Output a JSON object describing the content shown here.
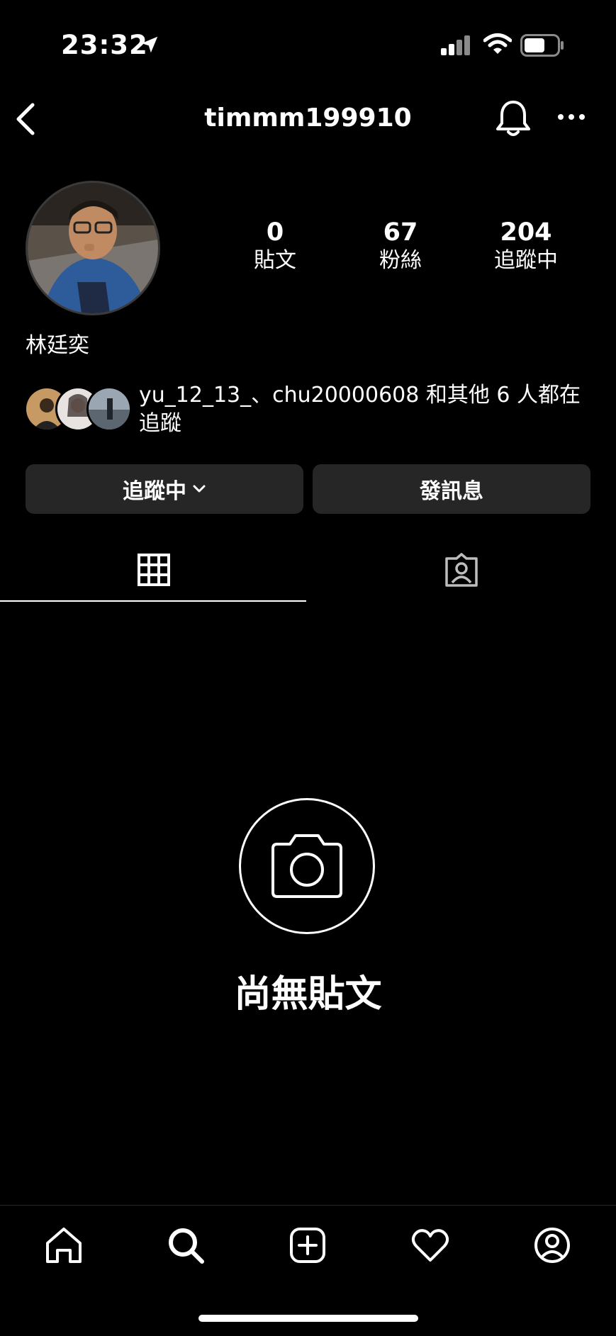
{
  "status_bar": {
    "time": "23:32"
  },
  "header": {
    "username": "timmm199910"
  },
  "profile": {
    "stats": [
      {
        "value": "0",
        "label": "貼文"
      },
      {
        "value": "67",
        "label": "粉絲"
      },
      {
        "value": "204",
        "label": "追蹤中"
      }
    ],
    "full_name": "林廷奕",
    "mutual_followers_text": "yu_12_13_、chu20000608 和其他 6 人都在追蹤"
  },
  "actions": {
    "following_label": "追蹤中",
    "message_label": "發訊息"
  },
  "tabs": [
    {
      "icon": "grid-icon",
      "selected": true
    },
    {
      "icon": "tagged-icon",
      "selected": false
    }
  ],
  "empty_state": {
    "text": "尚無貼文"
  },
  "bottom_nav": [
    "home-icon",
    "search-icon",
    "add-post-icon",
    "heart-icon",
    "profile-icon"
  ],
  "colors": {
    "background": "#000000",
    "button_bg": "#262626",
    "text": "#ffffff"
  }
}
